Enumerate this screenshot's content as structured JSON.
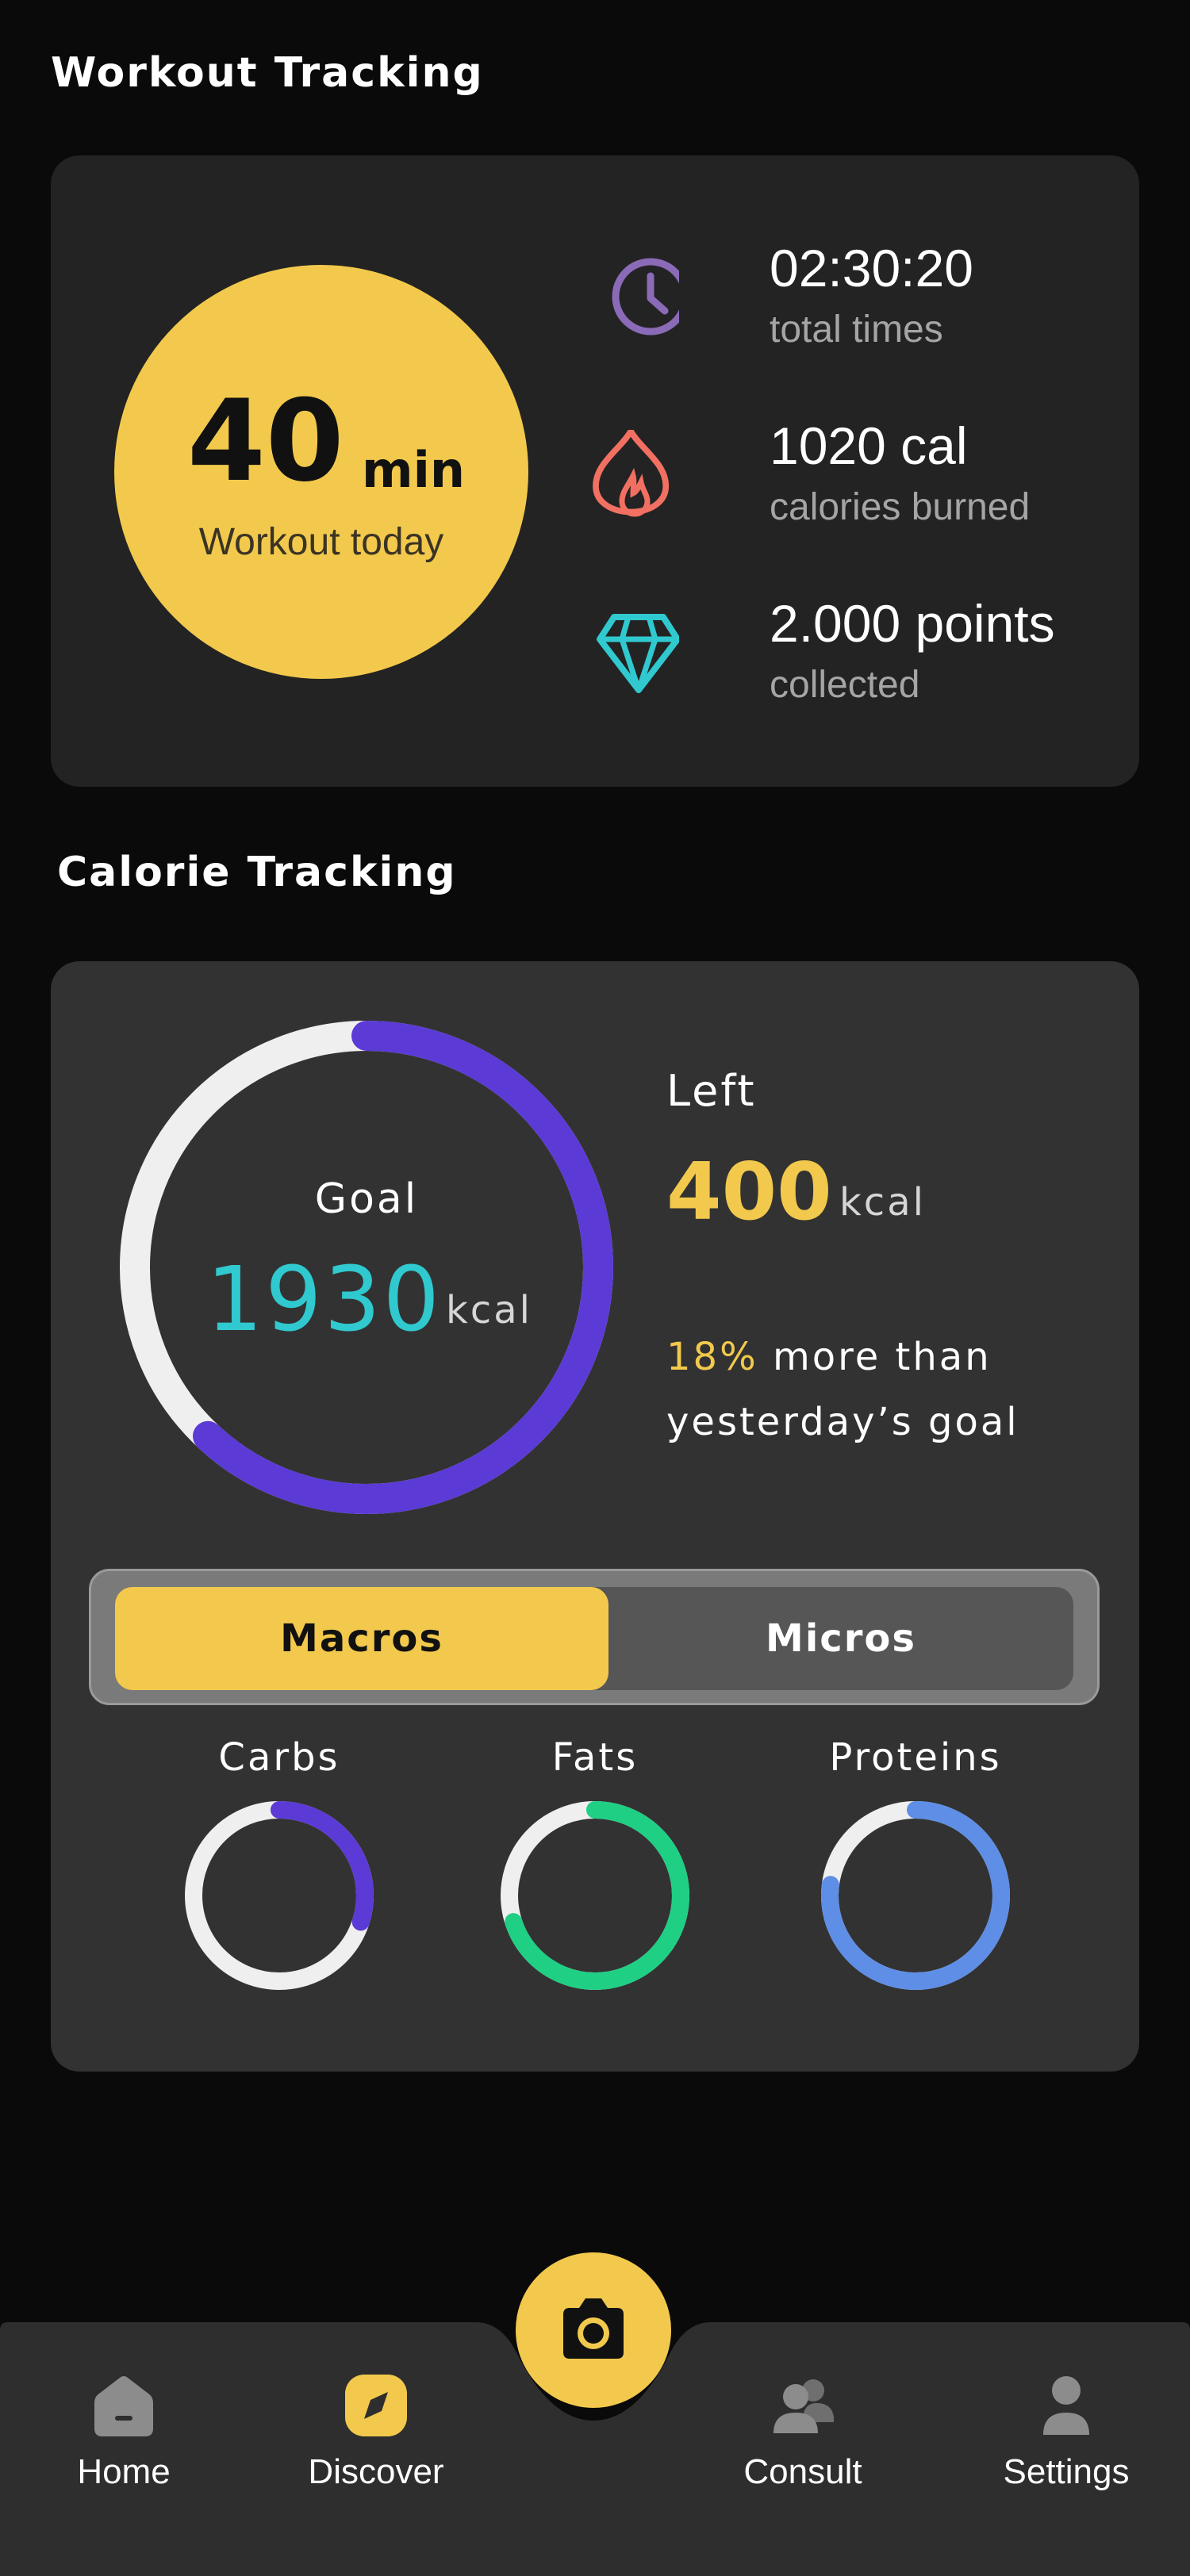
{
  "workout": {
    "title": "Workout Tracking",
    "minutes": "40",
    "minutes_unit": "min",
    "minutes_caption": "Workout today",
    "stats": [
      {
        "icon": "clock-icon",
        "value": "02:30:20",
        "label": "total times",
        "color": "#8b6bb8"
      },
      {
        "icon": "flame-icon",
        "value": "1020 cal",
        "label": "calories burned",
        "color": "#f27062"
      },
      {
        "icon": "diamond-icon",
        "value": "2.000 points",
        "label": "collected",
        "color": "#2fc9cf"
      }
    ]
  },
  "calorie": {
    "title": "Calorie Tracking",
    "goal_label": "Goal",
    "goal_value": "1930",
    "goal_unit": "kcal",
    "left_label": "Left",
    "left_value": "400",
    "left_unit": "kcal",
    "compare_pct": "18%",
    "compare_text": " more than yesterday’s goal",
    "goal_progress": 0.62,
    "tabs": {
      "active": "Macros",
      "inactive": "Micros"
    },
    "macros": [
      {
        "label": "Carbs",
        "progress": 0.3,
        "color": "#5b3ad6"
      },
      {
        "label": "Fats",
        "progress": 0.7,
        "color": "#1fcf84"
      },
      {
        "label": "Proteins",
        "progress": 0.77,
        "color": "#5e8ee6"
      }
    ]
  },
  "nav": {
    "items": [
      {
        "label": "Home",
        "icon": "home-icon"
      },
      {
        "label": "Discover",
        "icon": "compass-icon"
      },
      {
        "label": "Consult",
        "icon": "users-icon"
      },
      {
        "label": "Settings",
        "icon": "user-icon"
      }
    ],
    "center_icon": "camera-icon"
  },
  "colors": {
    "accent": "#f2c94c",
    "goal_ring": "#5b3ad6",
    "ring_track": "#efefef",
    "cyan": "#2fc9cf"
  }
}
